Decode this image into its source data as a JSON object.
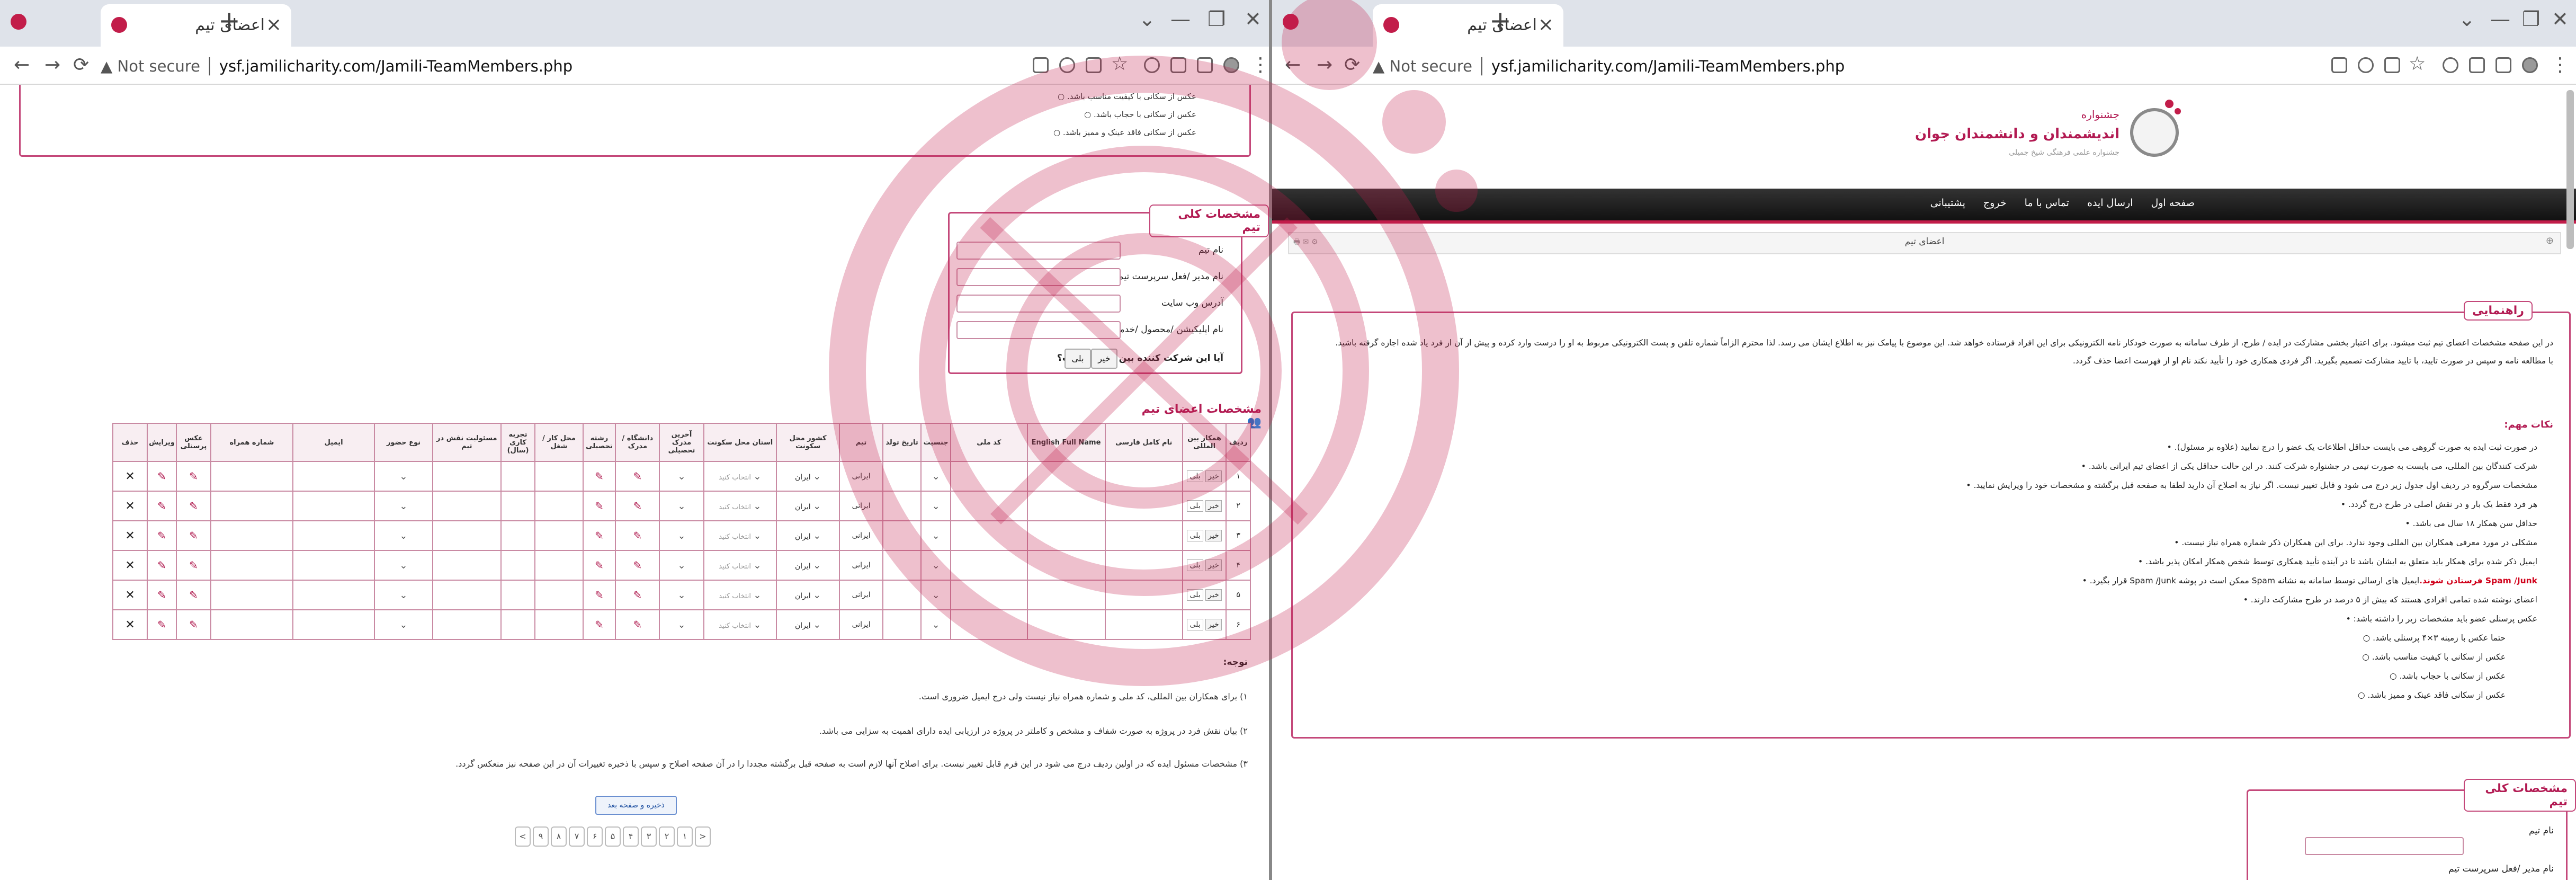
{
  "left_window": {
    "tab_title": "اعضای تیم",
    "url_prefix": "Not secure",
    "url": "ysf.jamilicharity.com/Jamili-TeamMembers.php",
    "top_bullets": [
      "عکس از سکانی با کیفیت مناسب باشد.",
      "عکس از سکانی با حجاب باشد.",
      "عکس از سکانی فاقد عینک و ممیز باشد."
    ],
    "team_section": {
      "legend": "مشخصات کلی تیم",
      "fields": [
        "نام تیم",
        "نام مدیر /فعل سرپرست تیم",
        "آدرس وب سایت",
        "نام اپلیکیشن /محصول /خدمت /فرآیند"
      ],
      "question": "آیا این شرکت کننده بین المللی است؟",
      "yes": "خیر",
      "no": "بلی"
    },
    "members_section": {
      "legend": "مشخصات اعضای تیم",
      "headers": [
        "ردیف",
        "همکار بین المللی",
        "نام کامل فارسی",
        "English Full Name",
        "کد ملی",
        "جنسیت",
        "تاریخ تولد",
        "تیم",
        "کشور محل سکونت",
        "استان محل سکونت",
        "آخرین مدرک تحصیلی",
        "دانشگاه / مدرک",
        "رشته تحصیلی",
        "محل کار / شغل",
        "تجربه کاری (سال)",
        "مسئولیت نقش در تیم",
        "نوع حضور",
        "ایمیل",
        "شماره همراه",
        "عکس پرسنلی",
        "ویرایش",
        "حذف"
      ],
      "rows": [
        {
          "n": "۱",
          "q1": "خیر",
          "q2": "بلی",
          "nat": "ایرانی",
          "country": "ایران",
          "prov": "انتخاب کنید"
        },
        {
          "n": "۲",
          "q1": "خیر",
          "q2": "بلی",
          "nat": "ایرانی",
          "country": "ایران",
          "prov": "انتخاب کنید"
        },
        {
          "n": "۳",
          "q1": "خیر",
          "q2": "بلی",
          "nat": "ایرانی",
          "country": "ایران",
          "prov": "انتخاب کنید"
        },
        {
          "n": "۴",
          "q1": "خیر",
          "q2": "بلی",
          "nat": "ایرانی",
          "country": "ایران",
          "prov": "انتخاب کنید"
        },
        {
          "n": "۵",
          "q1": "خیر",
          "q2": "بلی",
          "nat": "ایرانی",
          "country": "ایران",
          "prov": "انتخاب کنید"
        },
        {
          "n": "۶",
          "q1": "خیر",
          "q2": "بلی",
          "nat": "ایرانی",
          "country": "ایران",
          "prov": "انتخاب کنید"
        }
      ]
    },
    "notes": {
      "title": "توجه:",
      "items": [
        "۱) برای همکاران بین المللی، کد ملی و شماره همراه نیاز نیست ولی درج ایمیل ضروری است.",
        "۲) بیان نقش فرد در پروژه به صورت شفاف و مشخص و کاملتر در پروژه در ارزیابی ایده دارای اهمیت به سزایی می باشد.",
        "۳) مشخصات مسئول ایده که در اولین ردیف درج می شود در این فرم قابل تغییر نیست. برای اصلاح آنها لازم است به صفحه قبل برگشته مجددا را در آن صفحه اصلاح و سپس با ذخیره تغییرات آن در این صفحه نیز منعکس گردد."
      ]
    },
    "save_button": "ذخیره و صفحه بعد",
    "pager": [
      "<",
      "۱",
      "۲",
      "۳",
      "۴",
      "۵",
      "۶",
      "۷",
      "۸",
      "۹",
      ">"
    ]
  },
  "right_window": {
    "tab_title": "اعضای تیم",
    "url_prefix": "Not secure",
    "url": "ysf.jamilicharity.com/Jamili-TeamMembers.php",
    "brand_small": "جشنواره",
    "brand_title": "اندیشمندان و دانشمندان جوان",
    "brand_sub": "جشنواره علمی فرهنگی شیخ جمیلی",
    "menu": [
      "صفحه اول",
      "ارسال ایده",
      "تماس با ما",
      "خروج",
      "پشتیبانی"
    ],
    "page_title": "اعضای تیم",
    "guide": {
      "legend": "راهنمایی",
      "intro": "در این صفحه مشخصات اعضای تیم ثبت میشود. برای اعتبار بخشی مشارکت در ایده / طرح، از طرف سامانه به صورت خودکار نامه الکترونیکی برای این افراد فرستاده خواهد شد. این موضوع با پیامک نیز به اطلاع ایشان می رسد. لذا محترم الزاماً شماره تلفن و پست الکترونیکی مربوط به او را درست وارد کرده و پیش از آن از فرد یاد شده اجازه گرفته باشید.",
      "intro2": "با مطالعه نامه و سپس در صورت تایید، با تایید مشارکت تصمیم بگیرید. اگر فردی همکاری خود را تأیید نکند نام او از فهرست اعضا حذف گردد.",
      "tips_title": "نکات مهم:",
      "tips": [
        "در صورت ثبت ایده به صورت گروهی می بایست حداقل اطلاعات یک عضو را درج نمایید (علاوه بر مسئول).",
        "شرکت کنندگان بین المللی، می بایست به صورت تیمی در جشنواره شرکت کنند. در این حالت حداقل یکی از اعضای تیم ایرانی باشد.",
        "مشخصات سرگروه در ردیف اول جدول زیر درج می شود و قابل تغییر نیست. اگر نیاز به اصلاح آن دارید لطفا به صفحه قبل برگشته و مشخصات خود را ویرایش نمایید.",
        "هر فرد فقط یک بار و در نقش اصلی در طرح درج گردد.",
        "حداقل سن همکار ۱۸ سال می باشد.",
        "مشکلی در مورد معرفی همکاران بین المللی وجود ندارد. برای این همکاران ذکر شماره همراه نیاز نیست.",
        "ایمیل ذکر شده برای همکار باید متعلق به ایشان باشد تا در آینده تأیید همکاری توسط شخص همکار امکان پذیر باشد.",
        "ایمیل های ارسالی توسط سامانه به نشانه Spam ممکن است در پوشه Spam /Junk قرار بگیرد.",
        "اعضای نوشته شده تمامی افرادی هستند که بیش از ۵ درصد در طرح مشارکت دارند.",
        "عکس پرسنلی عضو باید مشخصات زیر را داشته باشد:"
      ],
      "tip_highlight": "Spam /Junk فرستادن شوند.",
      "photo_rules": [
        "حتما عکس با زمینه ۳×۴ پرسنلی باشد.",
        "عکس از سکانی با کیفیت مناسب باشد.",
        "عکس از سکانی با حجاب باشد.",
        "عکس از سکانی فاقد عینک و ممیز باشد."
      ]
    },
    "team_section": {
      "legend": "مشخصات کلی تیم",
      "field1": "نام تیم",
      "field2": "نام مدیر /فعل سرپرست تیم"
    }
  },
  "colors": {
    "accent": "#c21d4a",
    "border": "#c98aa3",
    "menubar": "#1a1a1a"
  }
}
